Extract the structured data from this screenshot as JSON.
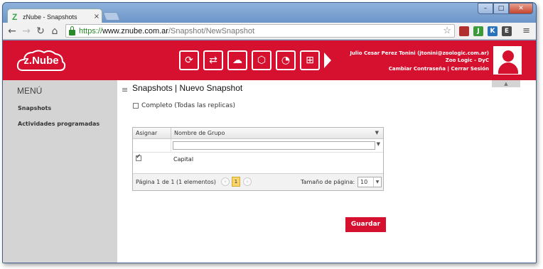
{
  "browser": {
    "tab_title": "zNube - Snapshots",
    "tab_close": "×",
    "favicon_letter": "Z",
    "url_scheme": "https://",
    "url_host": "www.znube.com.ar",
    "url_path": "/Snapshot/NewSnapshot",
    "window_buttons": [
      "–",
      "□",
      "✕"
    ]
  },
  "extensions": [
    {
      "name": "ext-red-icon",
      "color": "#b03030",
      "label": ""
    },
    {
      "name": "ext-green-icon",
      "color": "#3c9a3c",
      "label": "J"
    },
    {
      "name": "ext-k-icon",
      "color": "#2a73b8",
      "label": "K"
    },
    {
      "name": "ext-evernote-icon",
      "color": "#4a4a4a",
      "label": "E"
    }
  ],
  "header": {
    "logo": "z.Nube",
    "user_name": "Julio Cesar Perez Tonini (jtonini@zoologic.com.ar)",
    "user_company": "Zoo Logic - DyC",
    "change_password": "Cambiar Contraseña",
    "separator": "|",
    "logout": "Cerrar Sesión",
    "icons": [
      "sync-icon",
      "transfer-icon",
      "cloud-settings-icon",
      "cube-icon",
      "clock-icon",
      "gift-icon"
    ]
  },
  "sidebar": {
    "title": "MENÚ",
    "items": [
      {
        "label": "Snapshots"
      },
      {
        "label": "Actividades programadas"
      }
    ]
  },
  "main": {
    "title": "Snapshots | Nuevo Snapshot",
    "complete_label": "Completo (Todas las replicas)",
    "grid": {
      "columns": [
        "Asignar",
        "Nombre de Grupo"
      ],
      "rows": [
        {
          "assigned": true,
          "name": "Capital"
        }
      ],
      "pager_info": "Página 1 de 1 (1 elementos)",
      "current_page": "1",
      "page_size_label": "Tamaño de página:",
      "page_size": "10"
    },
    "save_label": "Guardar"
  },
  "colors": {
    "brand": "#d6112f",
    "sidebar": "#d4d4d4",
    "pager_active": "#fbd56b"
  }
}
